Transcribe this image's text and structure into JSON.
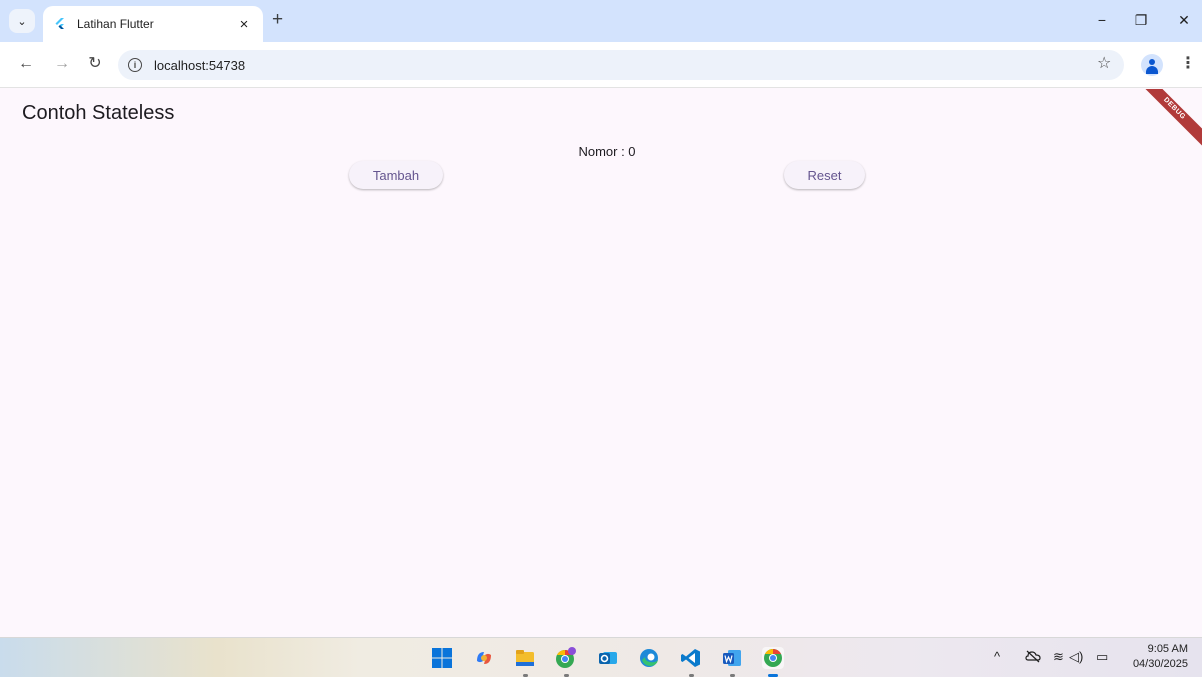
{
  "browser": {
    "tab_title": "Latihan Flutter",
    "tab_close": "×",
    "new_tab": "+",
    "url": "localhost:54738",
    "window_controls": {
      "minimize": "−",
      "restore": "❐",
      "close": "✕"
    },
    "nav": {
      "back": "←",
      "forward": "→",
      "reload": "↻"
    },
    "star": "☆",
    "menu": "⋮",
    "tab_search": "⌄",
    "info": "i"
  },
  "app": {
    "title": "Contoh Stateless",
    "counter_text": "Nomor : 0",
    "buttons": {
      "tambah": "Tambah",
      "reset": "Reset"
    },
    "debug_banner": "DEBUG"
  },
  "taskbar": {
    "icons": [
      "windows-start-icon",
      "copilot-icon",
      "file-explorer-icon",
      "chrome-badge-icon",
      "outlook-icon",
      "edge-icon",
      "vscode-icon",
      "word-icon",
      "chrome-icon"
    ],
    "tray": {
      "chevron": "^",
      "wifi": "≋",
      "volume": "◁)",
      "battery": "▭"
    },
    "time": "9:05 AM",
    "date": "04/30/2025"
  },
  "colors": {
    "tab_strip": "#d3e3fd",
    "app_background": "#fdf7fd",
    "button_text": "#65558f",
    "debug_ribbon": "#b13a3a"
  }
}
